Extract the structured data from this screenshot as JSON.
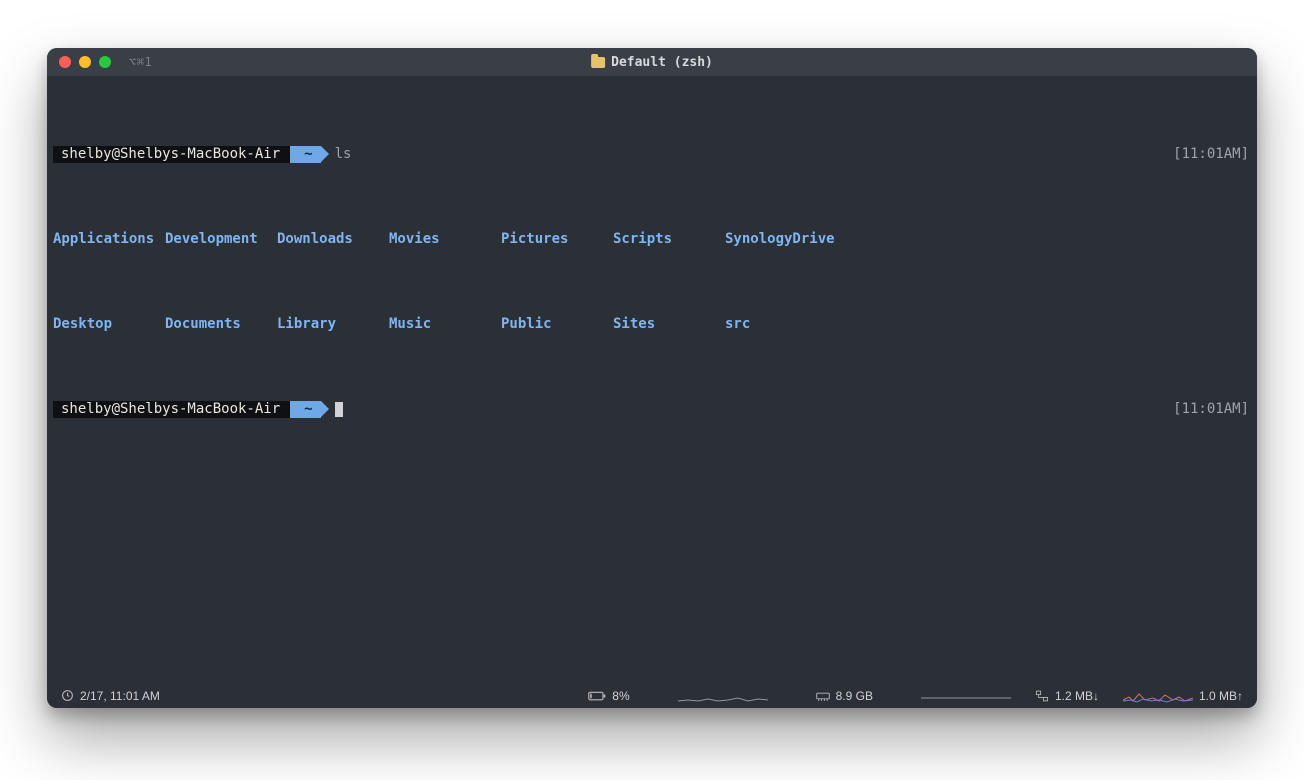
{
  "titlebar": {
    "tab_hint": "⌥⌘1",
    "title": "Default (zsh)"
  },
  "prompt1": {
    "host": "shelby@Shelbys-MacBook-Air",
    "path": "~",
    "command": "ls",
    "time": "[11:01AM]"
  },
  "ls_output": {
    "row1": [
      "Applications",
      "Development",
      "Downloads",
      "Movies",
      "Pictures",
      "Scripts",
      "SynologyDrive"
    ],
    "row2": [
      "Desktop",
      "Documents",
      "Library",
      "Music",
      "Public",
      "Sites",
      "src"
    ]
  },
  "prompt2": {
    "host": "shelby@Shelbys-MacBook-Air",
    "path": "~",
    "time": "[11:01AM]"
  },
  "statusbar": {
    "datetime": "2/17, 11:01 AM",
    "battery_pct": "8%",
    "memory": "8.9 GB",
    "net_down": "1.2 MB↓",
    "net_up": "1.0 MB↑"
  }
}
